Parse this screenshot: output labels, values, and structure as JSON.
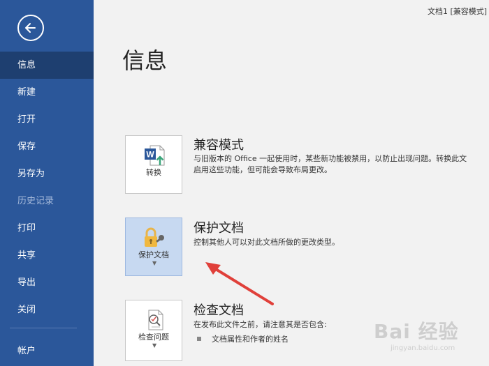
{
  "window": {
    "doc_title": "文档1 [兼容模式]"
  },
  "sidebar": {
    "items": [
      {
        "label": "信息"
      },
      {
        "label": "新建"
      },
      {
        "label": "打开"
      },
      {
        "label": "保存"
      },
      {
        "label": "另存为"
      },
      {
        "label": "历史记录"
      },
      {
        "label": "打印"
      },
      {
        "label": "共享"
      },
      {
        "label": "导出"
      },
      {
        "label": "关闭"
      }
    ],
    "account": "帐户"
  },
  "main": {
    "title": "信息",
    "compat": {
      "button_label": "转换",
      "title": "兼容模式",
      "desc_line1": "与旧版本的 Office 一起使用时，某些新功能被禁用，以防止出现问题。转换此文",
      "desc_line2": "启用这些功能，但可能会导致布局更改。"
    },
    "protect": {
      "button_label": "保护文档",
      "title": "保护文档",
      "desc": "控制其他人可以对此文档所做的更改类型。"
    },
    "inspect": {
      "button_label": "检查问题",
      "title": "检查文档",
      "desc": "在发布此文件之前，请注意其是否包含:",
      "bullet": "文档属性和作者的姓名"
    }
  },
  "watermark": {
    "text": "Bai 经验",
    "url": "jingyan.baidu.com"
  },
  "colors": {
    "sidebar": "#2b579a",
    "sidebar_active": "#1e3f70",
    "selected_button": "#c7d9f1",
    "arrow": "#e0403a",
    "background": "#f2f2f2"
  }
}
